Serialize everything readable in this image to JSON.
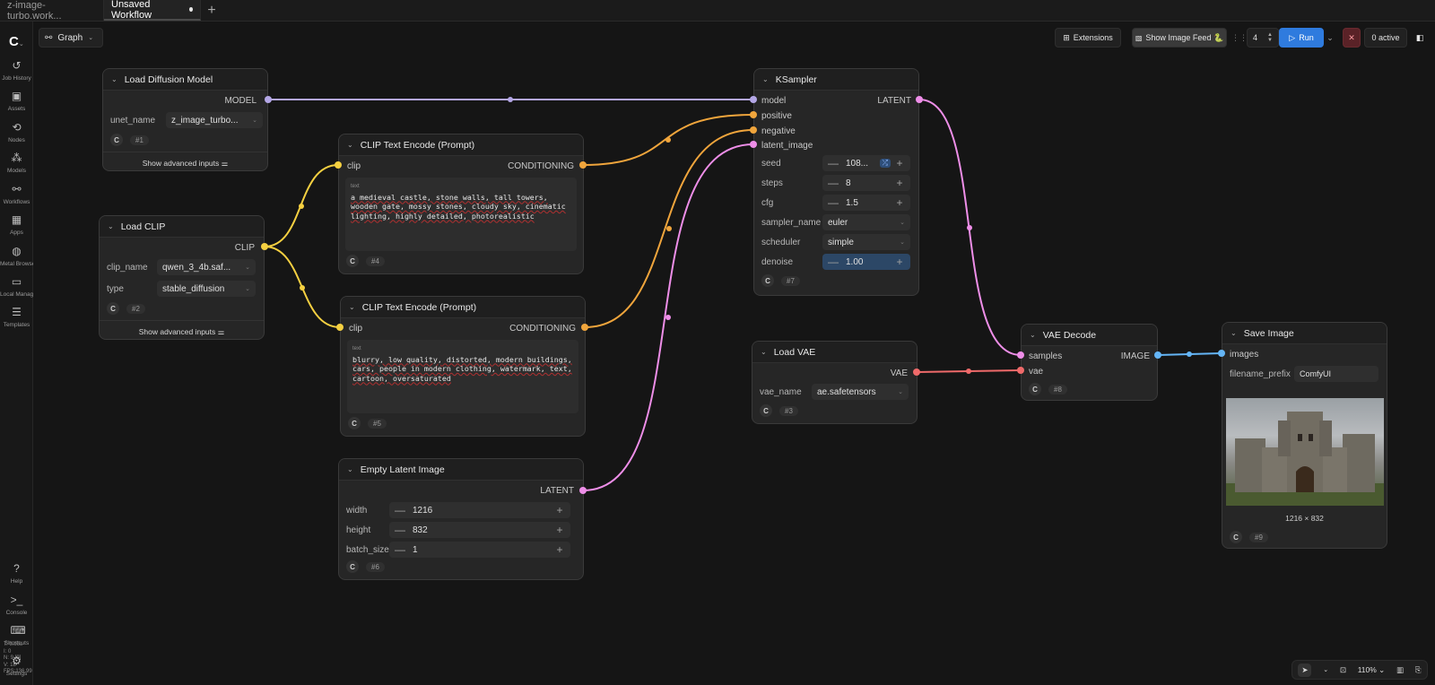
{
  "tabs": [
    {
      "label": "z-image-turbo.work...",
      "active": false
    },
    {
      "label": "Unsaved Workflow",
      "active": true,
      "unsaved": true
    }
  ],
  "sidebar": {
    "items": [
      {
        "label": "Job History",
        "icon": "history-icon"
      },
      {
        "label": "Assets",
        "icon": "image-icon"
      },
      {
        "label": "Nodes",
        "icon": "nodes-icon"
      },
      {
        "label": "Models",
        "icon": "models-icon"
      },
      {
        "label": "Workflows",
        "icon": "workflow-icon"
      },
      {
        "label": "Apps",
        "icon": "apps-icon"
      },
      {
        "label": "Metal Browser",
        "icon": "globe-icon"
      },
      {
        "label": "Local Manager",
        "icon": "folder-icon"
      },
      {
        "label": "Templates",
        "icon": "templates-icon"
      },
      {
        "label": "Help",
        "icon": "help-icon"
      },
      {
        "label": "Console",
        "icon": "terminal-icon"
      },
      {
        "label": "Shortcuts",
        "icon": "keyboard-icon"
      },
      {
        "label": "Settings",
        "icon": "gear-icon"
      }
    ],
    "stats": [
      "T: 0.00s",
      "I: 0",
      "N: 9 [9]",
      "V: 18",
      "FPS:136.99"
    ]
  },
  "toolbar": {
    "graph_label": "Graph",
    "extensions_label": "Extensions",
    "image_feed_label": "Show Image Feed 🐍",
    "queue_count": "4",
    "run_label": "Run",
    "active_label": "0 active"
  },
  "nodes": {
    "load_diffusion": {
      "title": "Load Diffusion Model",
      "output": "MODEL",
      "widget_label": "unet_name",
      "widget_value": "z_image_turbo...",
      "id": "#1",
      "advanced": "Show advanced inputs"
    },
    "load_clip": {
      "title": "Load CLIP",
      "output": "CLIP",
      "clip_name_label": "clip_name",
      "clip_name_value": "qwen_3_4b.saf...",
      "type_label": "type",
      "type_value": "stable_diffusion",
      "id": "#2",
      "advanced": "Show advanced inputs"
    },
    "clip_pos": {
      "title": "CLIP Text Encode (Prompt)",
      "input": "clip",
      "output": "CONDITIONING",
      "text_label": "text",
      "text": "a medieval castle, stone walls, tall towers, wooden gate, mossy stones, cloudy sky, cinematic lighting, highly detailed, photorealistic",
      "id": "#4"
    },
    "clip_neg": {
      "title": "CLIP Text Encode (Prompt)",
      "input": "clip",
      "output": "CONDITIONING",
      "text_label": "text",
      "text": "blurry, low quality, distorted, modern buildings, cars, people in modern clothing, watermark, text, cartoon, oversaturated",
      "id": "#5"
    },
    "empty_latent": {
      "title": "Empty Latent Image",
      "output": "LATENT",
      "width_label": "width",
      "width": "1216",
      "height_label": "height",
      "height": "832",
      "batch_label": "batch_size",
      "batch": "1",
      "id": "#6"
    },
    "ksampler": {
      "title": "KSampler",
      "inputs": [
        "model",
        "positive",
        "negative",
        "latent_image"
      ],
      "output": "LATENT",
      "seed_label": "seed",
      "seed": "108...",
      "steps_label": "steps",
      "steps": "8",
      "cfg_label": "cfg",
      "cfg": "1.5",
      "sampler_label": "sampler_name",
      "sampler": "euler",
      "scheduler_label": "scheduler",
      "scheduler": "simple",
      "denoise_label": "denoise",
      "denoise": "1.00",
      "denoise_fraction": 1.0,
      "id": "#7"
    },
    "load_vae": {
      "title": "Load VAE",
      "output": "VAE",
      "widget_label": "vae_name",
      "widget_value": "ae.safetensors",
      "id": "#3"
    },
    "vae_decode": {
      "title": "VAE Decode",
      "inputs": [
        "samples",
        "vae"
      ],
      "output": "IMAGE",
      "id": "#8"
    },
    "save_image": {
      "title": "Save Image",
      "input": "images",
      "prefix_label": "filename_prefix",
      "prefix_value": "ComfyUI",
      "image_size": "1216 × 832",
      "id": "#9"
    }
  },
  "zoom": {
    "level": "110%"
  },
  "colors": {
    "model": "#b4a7e6",
    "clip": "#f5d041",
    "conditioning": "#f0a53c",
    "latent": "#ee8ee8",
    "vae": "#ef6a6a",
    "image": "#64b5f6",
    "accent": "#2f7bde"
  }
}
